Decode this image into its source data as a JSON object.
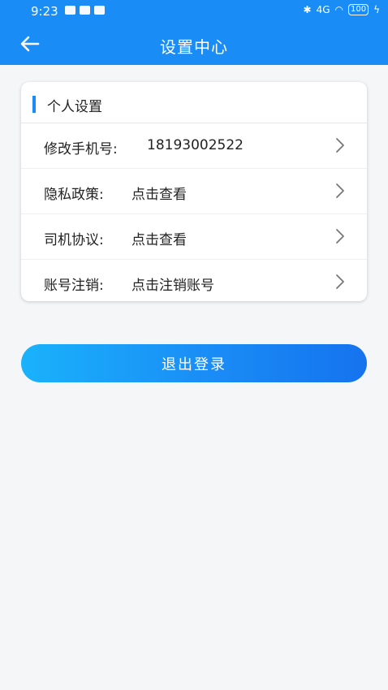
{
  "status_bar": {
    "time": "9:23",
    "network": "4G",
    "battery": "100"
  },
  "header": {
    "title": "设置中心",
    "back_icon": "arrow-left-icon"
  },
  "section": {
    "title": "个人设置",
    "items": [
      {
        "label": "修改手机号:",
        "value": "18193002522"
      },
      {
        "label": "隐私政策:",
        "value": "点击查看"
      },
      {
        "label": "司机协议:",
        "value": "点击查看"
      },
      {
        "label": "账号注销:",
        "value": "点击注销账号"
      }
    ]
  },
  "logout_label": "退出登录",
  "colors": {
    "primary": "#1a8cf6",
    "background": "#f5f6f8"
  }
}
